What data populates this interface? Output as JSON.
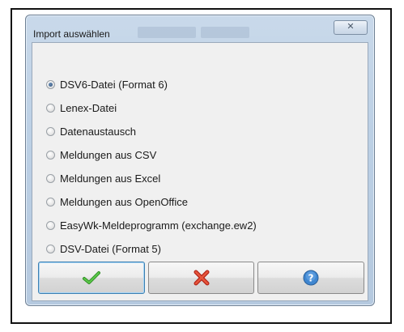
{
  "window": {
    "title": "Import auswählen",
    "close_glyph": "✕"
  },
  "import_options": [
    {
      "label": "DSV6-Datei (Format 6)",
      "checked": true
    },
    {
      "label": "Lenex-Datei",
      "checked": false
    },
    {
      "label": "Datenaustausch",
      "checked": false
    },
    {
      "label": "Meldungen aus CSV",
      "checked": false
    },
    {
      "label": "Meldungen aus Excel",
      "checked": false
    },
    {
      "label": "Meldungen aus OpenOffice",
      "checked": false
    },
    {
      "label": "EasyWk-Meldeprogramm (exchange.ew2)",
      "checked": false
    },
    {
      "label": "DSV-Datei (Format 5)",
      "checked": false
    }
  ],
  "buttons": {
    "ok_icon": "checkmark-icon",
    "cancel_icon": "red-x-icon",
    "help_icon": "help-icon"
  },
  "colors": {
    "title_bar": "#bcd0e5",
    "client_bg": "#f0f0f0",
    "ok_green": "#3aa52a",
    "cancel_red": "#d6321e",
    "help_blue": "#3f86d0"
  }
}
